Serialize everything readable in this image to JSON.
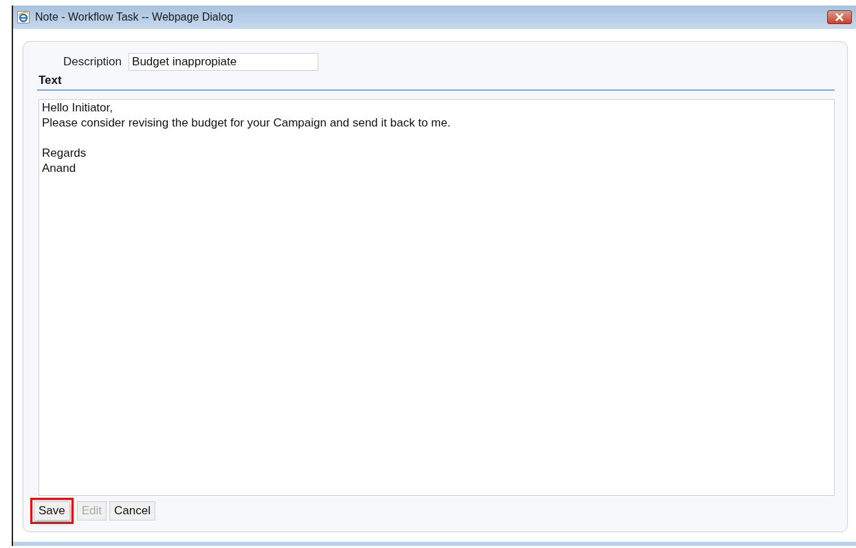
{
  "window": {
    "title": "Note - Workflow Task -- Webpage Dialog"
  },
  "description": {
    "label": "Description",
    "value": "Budget inappropiate"
  },
  "text_section": {
    "heading": "Text",
    "value": "Hello Initiator,\nPlease consider revising the budget for your Campaign and send it back to me.\n\nRegards\nAnand"
  },
  "buttons": [
    {
      "label": "Save",
      "disabled": false,
      "highlighted": true
    },
    {
      "label": "Edit",
      "disabled": true,
      "highlighted": false
    },
    {
      "label": "Cancel",
      "disabled": false,
      "highlighted": false
    }
  ]
}
